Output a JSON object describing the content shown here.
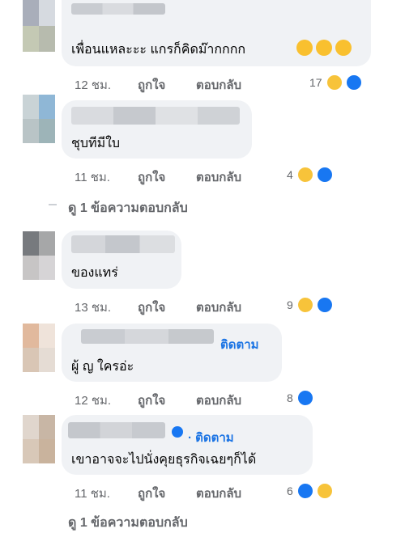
{
  "comments": [
    {
      "text": "เพื่อนแหละะะ แกรก็คิดม๊ากกกก",
      "time": "12 ชม.",
      "like_label": "ถูกใจ",
      "reply_label": "ตอบกลับ",
      "reaction_count": "17",
      "reactions": [
        "haha-icon",
        "like-icon"
      ],
      "emojis": [
        "rofl-emoji",
        "rofl-emoji",
        "rofl-emoji"
      ]
    },
    {
      "text": "ชุบทีมีใบ",
      "time": "11 ชม.",
      "like_label": "ถูกใจ",
      "reply_label": "ตอบกลับ",
      "reaction_count": "4",
      "reactions": [
        "haha-icon",
        "like-icon"
      ],
      "view_replies": "ดู 1 ข้อความตอบกลับ"
    },
    {
      "text": "ของแทร่",
      "time": "13 ชม.",
      "like_label": "ถูกใจ",
      "reply_label": "ตอบกลับ",
      "reaction_count": "9",
      "reactions": [
        "haha-icon",
        "like-icon"
      ]
    },
    {
      "text": "ผู้ ญ ใครอ่ะ",
      "follow_label": "ติดตาม",
      "time": "12 ชม.",
      "like_label": "ถูกใจ",
      "reply_label": "ตอบกลับ",
      "reaction_count": "8",
      "reactions": [
        "like-icon"
      ]
    },
    {
      "text": "เขาอาจจะไปนั่งคุยธุรกิจเฉยๆก็ได้",
      "follow_label": "· ติดตาม",
      "verified": true,
      "time": "11 ชม.",
      "like_label": "ถูกใจ",
      "reply_label": "ตอบกลับ",
      "reaction_count": "6",
      "reactions": [
        "like-icon",
        "haha-icon"
      ],
      "view_replies": "ดู 1 ข้อความตอบกลับ"
    }
  ],
  "colors": {
    "bubble": "#f0f2f5",
    "meta_text": "#65676b",
    "follow_blue": "#1b74e4",
    "like_blue": "#1877f2",
    "haha_yellow": "#f7c33a"
  }
}
